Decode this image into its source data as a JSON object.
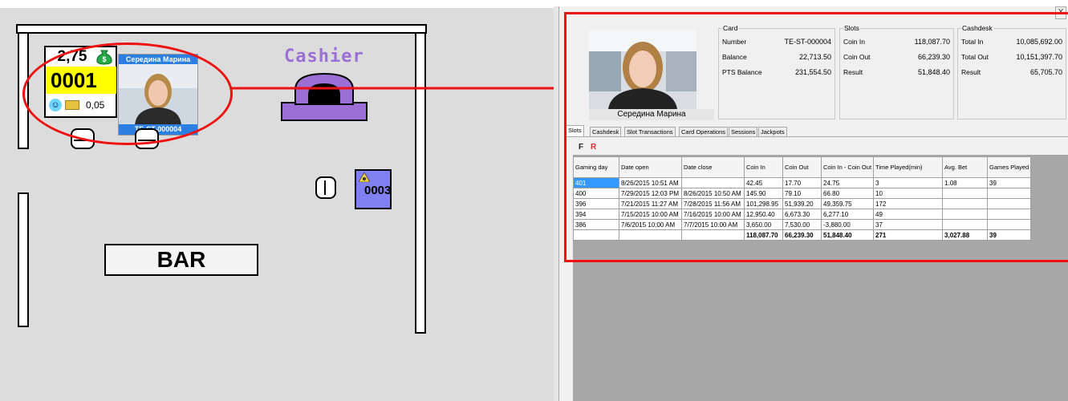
{
  "floor": {
    "machine1": {
      "credit": "2,75",
      "number": "0001",
      "bet": "0,05",
      "player_name": "Середина Марина",
      "card_id": "TE-ST-000004"
    },
    "cashier_label": "Cashier",
    "machine3": {
      "number": "0003"
    },
    "bar_label": "BAR"
  },
  "panel": {
    "close_label": "X",
    "player_name": "Середина Марина",
    "card": {
      "title": "Card",
      "rows": [
        {
          "label": "Number",
          "value": "TE-ST-000004"
        },
        {
          "label": "Balance",
          "value": "22,713.50"
        },
        {
          "label": "PTS Balance",
          "value": "231,554.50"
        }
      ]
    },
    "slots": {
      "title": "Slots",
      "rows": [
        {
          "label": "Coin In",
          "value": "118,087.70"
        },
        {
          "label": "Coin Out",
          "value": "66,239.30"
        },
        {
          "label": "Result",
          "value": "51,848.40"
        }
      ]
    },
    "cashdesk": {
      "title": "Cashdesk",
      "rows": [
        {
          "label": "Total In",
          "value": "10,085,692.00"
        },
        {
          "label": "Total Out",
          "value": "10,151,397.70"
        },
        {
          "label": "Result",
          "value": "65,705.70"
        }
      ]
    },
    "tabs": [
      "Slots",
      "Cashdesk",
      "Slot Transactions",
      "Card Operations",
      "Sessions",
      "Jackpots"
    ],
    "toolbar": {
      "f_label": "F",
      "r_label": "R"
    },
    "table": {
      "headers": [
        "Gaming day",
        "Date open",
        "Date close",
        "Coin In",
        "Coin Out",
        "Coin In - Coin Out",
        "Time Played(min)",
        "Avg. Bet",
        "Games Played"
      ],
      "rows": [
        [
          "401",
          "8/26/2015 10:51 AM",
          "",
          "42.45",
          "17.70",
          "24.75",
          "3",
          "1.08",
          "39"
        ],
        [
          "400",
          "7/29/2015 12:03 PM",
          "8/26/2015 10:50 AM",
          "145.90",
          "79.10",
          "66.80",
          "10",
          "",
          ""
        ],
        [
          "396",
          "7/21/2015 11:27 AM",
          "7/28/2015 11:56 AM",
          "101,298.95",
          "51,939.20",
          "49,359.75",
          "172",
          "",
          ""
        ],
        [
          "394",
          "7/15/2015 10:00 AM",
          "7/16/2015 10:00 AM",
          "12,950.40",
          "6,673.30",
          "6,277.10",
          "49",
          "",
          ""
        ],
        [
          "386",
          "7/6/2015 10:00 AM",
          "7/7/2015 10:00 AM",
          "3,650.00",
          "7,530.00",
          "-3,880.00",
          "37",
          "",
          ""
        ]
      ],
      "totals": [
        "",
        "",
        "",
        "118,087.70",
        "66,239.30",
        "51,848.40",
        "271",
        "3,027.88",
        "39"
      ]
    }
  },
  "colors": {
    "highlight": "#ee1111",
    "machine_number_bg": "#ffff00",
    "card_blue": "#2c7ee0",
    "cashier_purple": "#9b6fd6",
    "machine3_bg": "#8080f0",
    "selection_blue": "#3399ff"
  }
}
